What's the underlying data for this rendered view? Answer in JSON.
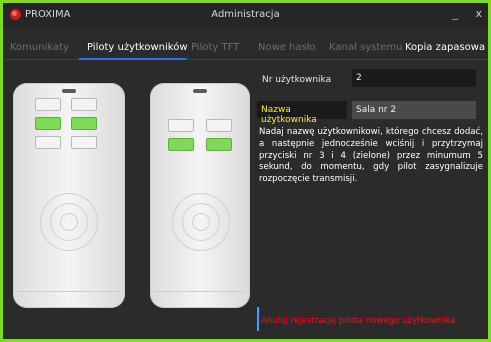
{
  "window": {
    "app_name": "PROXIMA",
    "title": "Administracja",
    "minimize_label": "_",
    "close_label": "x"
  },
  "tabs": [
    {
      "label": "Komunikaty",
      "active": false
    },
    {
      "label": "Piloty użytkowników",
      "active": true
    },
    {
      "label": "Piloty TFT",
      "active": false
    },
    {
      "label": "Nowe hasło",
      "active": false
    },
    {
      "label": "Kanał systemu",
      "active": false
    },
    {
      "label": "Kopia zapasowa",
      "active": false
    }
  ],
  "form": {
    "user_number_label": "Nr użytkownika",
    "user_number_value": "2",
    "user_name_label": "Nazwa użytkownika",
    "user_name_value": "Sala nr 2",
    "instructions": "Nadaj nazwę użytkownikowi, którego chcesz dodać, a następnie jednocześnie wciśnij i przytrzymaj przyciski nr 3 i 4 (zielone) przez minumum 5 sekund, do momentu, gdy pilot zasygnalizuje rozpoczęcie transmisji.",
    "cancel_link": "Anuluj rejestrację pilota nowego użytkownika"
  },
  "colors": {
    "accent_border": "#7ddc1f",
    "tab_underline": "#2e6fd6",
    "highlight_label": "#f2f21c",
    "cancel_text": "#e5161a",
    "remote_button_green": "#7ed957"
  },
  "remotes": [
    {
      "name": "6-button remote",
      "buttons": [
        "white",
        "white",
        "green",
        "green",
        "white",
        "white"
      ]
    },
    {
      "name": "4-button remote",
      "buttons": [
        "white",
        "white",
        "green",
        "green"
      ]
    }
  ]
}
